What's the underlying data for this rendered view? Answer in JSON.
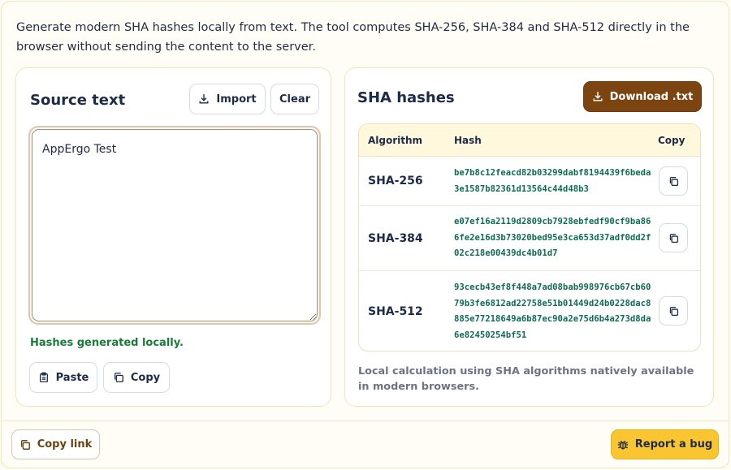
{
  "intro": "Generate modern SHA hashes locally from text. The tool computes SHA-256, SHA-384 and SHA-512 directly in the browser without sending the content to the server.",
  "source": {
    "title": "Source text",
    "import_label": "Import",
    "clear_label": "Clear",
    "text_value": "AppErgo Test",
    "status": "Hashes generated locally.",
    "paste_label": "Paste",
    "copy_label": "Copy"
  },
  "hashes": {
    "title": "SHA hashes",
    "download_label": "Download .txt",
    "columns": [
      "Algorithm",
      "Hash",
      "Copy"
    ],
    "rows": [
      {
        "algorithm": "SHA-256",
        "hash": "be7b8c12feacd82b03299dabf8194439f6beda3e1587b82361d13564c44d48b3"
      },
      {
        "algorithm": "SHA-384",
        "hash": "e07ef16a2119d2809cb7928ebfedf90cf9ba866fe2e16d3b73020bed95e3ca653d37adf0dd2f02c218e00439dc4b01d7"
      },
      {
        "algorithm": "SHA-512",
        "hash": "93cecb43ef8f448a7ad08bab998976cb67cb6079b3fe6812ad22758e51b01449d24b0228dac8885e77218649a6b87ec90a2e75d6b4a273d8da6e82450254bf51"
      }
    ],
    "note": "Local calculation using SHA algorithms natively available in modern browsers."
  },
  "footer": {
    "copy_link_label": "Copy link",
    "report_bug_label": "Report a bug"
  },
  "icons": {
    "import": "download-icon",
    "download": "download-icon",
    "paste": "clipboard-icon",
    "copy": "copy-icon",
    "copy_link": "copy-icon",
    "report": "bug-icon"
  },
  "colors": {
    "accent_brown": "#7b4411",
    "bug_yellow": "#f9c531",
    "status_green": "#1a7a3a",
    "hash_green": "#0f6a56",
    "title_navy": "#1c2b4a"
  }
}
